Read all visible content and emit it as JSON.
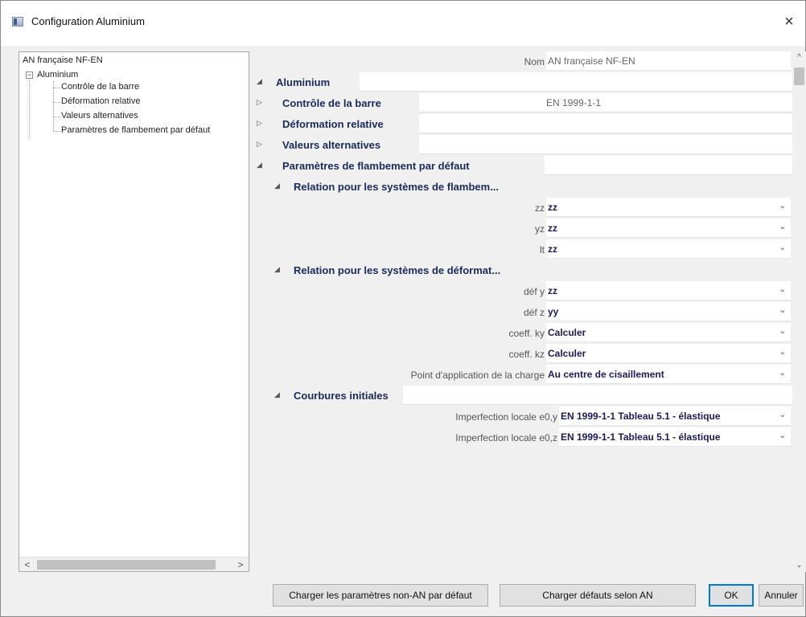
{
  "window": {
    "title": "Configuration Aluminium",
    "close_label": "×"
  },
  "tree": {
    "root": "AN française NF-EN",
    "expander": "−",
    "node": "Aluminium",
    "children": [
      "Contrôle de la barre",
      "Déformation relative",
      "Valeurs alternatives",
      "Paramètres de flambement par défaut"
    ],
    "scroll_left": "<",
    "scroll_right": ">"
  },
  "props": {
    "nom_label": "Nom",
    "nom_value": "AN française NF-EN",
    "aluminium": "Aluminium",
    "controle": "Contrôle de la barre",
    "controle_value": "EN 1999-1-1",
    "deformation": "Déformation relative",
    "valeurs": "Valeurs alternatives",
    "parametres": "Paramètres de flambement par défaut",
    "relation_flamb": "Relation pour les systèmes de flambem...",
    "zz_label": "zz",
    "zz_value": "zz",
    "yz_label": "yz",
    "yz_value": "zz",
    "lt_label": "lt",
    "lt_value": "zz",
    "relation_def": "Relation pour les systèmes de déformat...",
    "defy_label": "déf y",
    "defy_value": "zz",
    "defz_label": "déf z",
    "defz_value": "yy",
    "ky_label": "coeff. ky",
    "ky_value": "Calculer",
    "kz_label": "coeff. kz",
    "kz_value": "Calculer",
    "point_label": "Point d'application de la charge",
    "point_value": "Au centre de cisaillement",
    "courbures": "Courbures initiales",
    "e0y_label": "Imperfection locale e0,y",
    "e0y_value": "EN 1999-1-1 Tableau 5.1 - élastique",
    "e0z_label": "Imperfection locale e0,z",
    "e0z_value": "EN 1999-1-1 Tableau 5.1 - élastique",
    "expanded_arrow": "◢",
    "collapsed_arrow": "▷",
    "dropdown_arrow": "⌄"
  },
  "scroll": {
    "up": "^",
    "down": "⌄"
  },
  "buttons": {
    "charger_non_an": "Charger les paramètres non-AN par défaut",
    "charger_an": "Charger défauts selon AN",
    "ok": "OK",
    "annuler": "Annuler"
  }
}
